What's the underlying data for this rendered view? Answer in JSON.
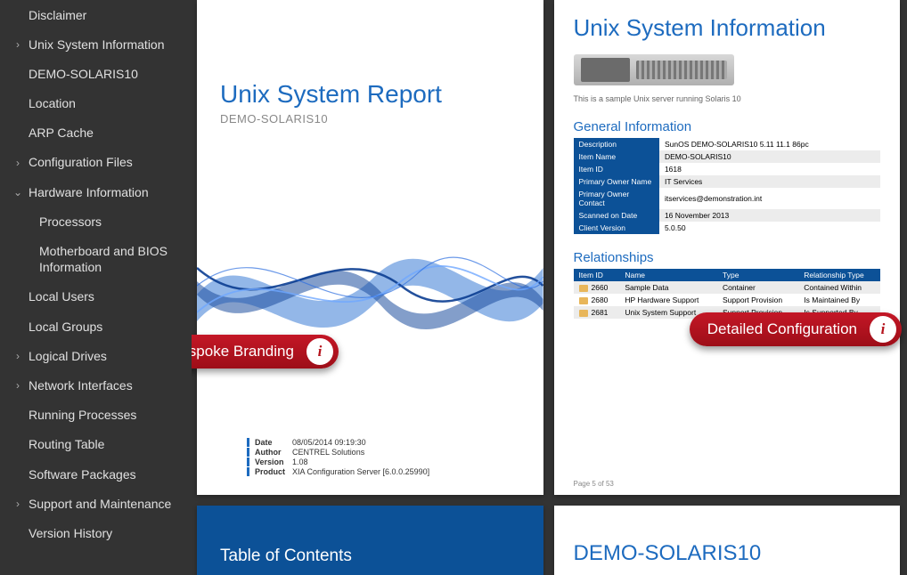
{
  "sidebar": {
    "items": [
      {
        "label": "Disclaimer",
        "expand": "",
        "level": 0
      },
      {
        "label": "Unix System Information",
        "expand": ">",
        "level": 0
      },
      {
        "label": "DEMO-SOLARIS10",
        "expand": "",
        "level": 0
      },
      {
        "label": "Location",
        "expand": "",
        "level": 0
      },
      {
        "label": "ARP Cache",
        "expand": "",
        "level": 0
      },
      {
        "label": "Configuration Files",
        "expand": ">",
        "level": 0
      },
      {
        "label": "Hardware Information",
        "expand": "v",
        "level": 0
      },
      {
        "label": "Processors",
        "expand": "",
        "level": 1
      },
      {
        "label": "Motherboard and BIOS Information",
        "expand": "",
        "level": 1
      },
      {
        "label": "Local Users",
        "expand": "",
        "level": 0
      },
      {
        "label": "Local Groups",
        "expand": "",
        "level": 0
      },
      {
        "label": "Logical Drives",
        "expand": ">",
        "level": 0
      },
      {
        "label": "Network Interfaces",
        "expand": ">",
        "level": 0
      },
      {
        "label": "Running Processes",
        "expand": "",
        "level": 0
      },
      {
        "label": "Routing Table",
        "expand": "",
        "level": 0
      },
      {
        "label": "Software Packages",
        "expand": "",
        "level": 0
      },
      {
        "label": "Support and Maintenance",
        "expand": ">",
        "level": 0
      },
      {
        "label": "Version History",
        "expand": "",
        "level": 0
      }
    ]
  },
  "report": {
    "title": "Unix System Report",
    "subtitle": "DEMO-SOLARIS10",
    "meta": [
      {
        "k": "Date",
        "v": "08/05/2014 09:19:30"
      },
      {
        "k": "Author",
        "v": "CENTREL Solutions"
      },
      {
        "k": "Version",
        "v": "1.08"
      },
      {
        "k": "Product",
        "v": "XIA Configuration Server [6.0.0.25990]"
      }
    ]
  },
  "toc_title": "Table of Contents",
  "sysinfo": {
    "title": "Unix System Information",
    "desc": "This is a sample Unix server running Solaris 10",
    "general_title": "General Information",
    "general": [
      {
        "k": "Description",
        "v": "SunOS DEMO-SOLARIS10 5.11 11.1 86pc"
      },
      {
        "k": "Item Name",
        "v": "DEMO-SOLARIS10"
      },
      {
        "k": "Item ID",
        "v": "1618"
      },
      {
        "k": "Primary Owner Name",
        "v": "IT Services"
      },
      {
        "k": "Primary Owner Contact",
        "v": "itservices@demonstration.int"
      },
      {
        "k": "Scanned on Date",
        "v": "16 November 2013"
      },
      {
        "k": "Client Version",
        "v": "5.0.50"
      }
    ],
    "rel_title": "Relationships",
    "rel_headers": [
      "Item ID",
      "Name",
      "Type",
      "Relationship Type"
    ],
    "relationships": [
      {
        "id": "2660",
        "name": "Sample Data",
        "type": "Container",
        "rel": "Contained Within"
      },
      {
        "id": "2680",
        "name": "HP Hardware Support",
        "type": "Support Provision",
        "rel": "Is Maintained By"
      },
      {
        "id": "2681",
        "name": "Unix System Support",
        "type": "Support Provision",
        "rel": "Is Supported By"
      }
    ],
    "page_num": "Page 5 of 53"
  },
  "demo_title": "DEMO-SOLARIS10",
  "callouts": {
    "bespoke": "Bespoke Branding",
    "detailed": "Detailed Configuration"
  }
}
